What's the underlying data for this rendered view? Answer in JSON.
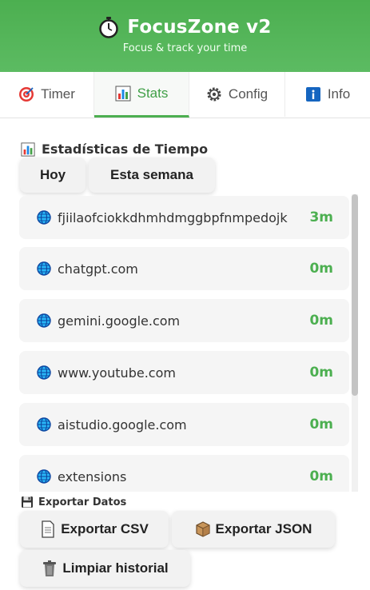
{
  "header": {
    "title": "FocusZone v2",
    "subtitle": "Focus & track your time",
    "icon": "stopwatch-icon",
    "bg_color": "#4caf50"
  },
  "tabs": [
    {
      "label": "Timer",
      "icon": "target-icon"
    },
    {
      "label": "Stats",
      "icon": "bar-chart-icon",
      "active": true
    },
    {
      "label": "Config",
      "icon": "gear-icon"
    },
    {
      "label": "Info",
      "icon": "info-icon"
    }
  ],
  "stats": {
    "title": "Estadísticas de Tiempo",
    "icon": "bar-chart-icon",
    "ranges": [
      {
        "label": "Hoy"
      },
      {
        "label": "Esta semana"
      }
    ],
    "items": [
      {
        "site": "fjiilaofciokkdhmhdmggbpfnmpedojk",
        "time": "3m"
      },
      {
        "site": "chatgpt.com",
        "time": "0m"
      },
      {
        "site": "gemini.google.com",
        "time": "0m"
      },
      {
        "site": "www.youtube.com",
        "time": "0m"
      },
      {
        "site": "aistudio.google.com",
        "time": "0m"
      },
      {
        "site": "extensions",
        "time": "0m"
      }
    ],
    "accent_color": "#4caf50"
  },
  "export": {
    "title": "Exportar Datos",
    "icon": "floppy-disk-icon",
    "csv_label": "Exportar CSV",
    "json_label": "Exportar JSON",
    "clear_label": "Limpiar historial"
  }
}
